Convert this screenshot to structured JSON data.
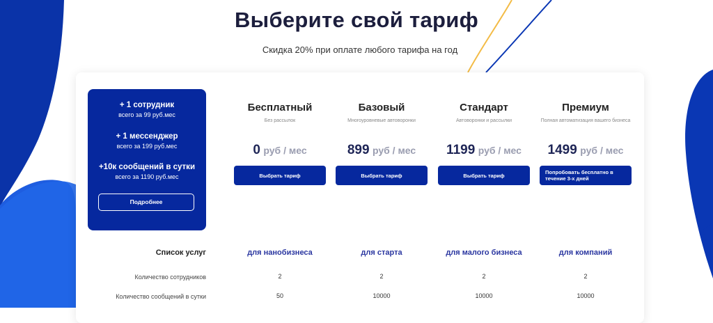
{
  "title": "Выберите свой тариф",
  "subtitle": "Скидка 20% при оплате любого тарифа на год",
  "promo": {
    "items": [
      {
        "head": "+ 1 сотрудник",
        "sub": "всего за 99 руб.мес"
      },
      {
        "head": "+ 1 мессенджер",
        "sub": "всего за 199 руб.мес"
      },
      {
        "head": "+10к сообщений в сутки",
        "sub": "всего за 1190 руб.мес"
      }
    ],
    "button": "Подробнее"
  },
  "plans": [
    {
      "name": "Бесплатный",
      "desc": "Без рассылок",
      "price": "0",
      "unit": "руб / мес",
      "button": "Выбрать тариф"
    },
    {
      "name": "Базовый",
      "desc": "Многоуровневые автоворонки",
      "price": "899",
      "unit": "руб / мес",
      "button": "Выбрать тариф"
    },
    {
      "name": "Стандарт",
      "desc": "Автоворонки и рассылки",
      "price": "1199",
      "unit": "руб / мес",
      "button": "Выбрать тариф"
    },
    {
      "name": "Премиум",
      "desc": "Полная автоматизация вашего бизнеса",
      "price": "1499",
      "unit": "руб / мес",
      "button": "Попробовать бесплатно в течение 3-х дней"
    }
  ],
  "table": {
    "header_label": "Список услуг",
    "segments": [
      "для нанобизнеса",
      "для старта",
      "для малого бизнеса",
      "для компаний"
    ],
    "rows": [
      {
        "label": "Количество сотрудников",
        "values": [
          "2",
          "2",
          "2",
          "2"
        ]
      },
      {
        "label": "Количество сообщений в сутки",
        "values": [
          "50",
          "10000",
          "10000",
          "10000"
        ]
      }
    ]
  },
  "colors": {
    "accent": "#06289e",
    "deco_blue": "#0a37b4",
    "deco_yellow": "#f3bb45",
    "title": "#1c1e3d"
  }
}
